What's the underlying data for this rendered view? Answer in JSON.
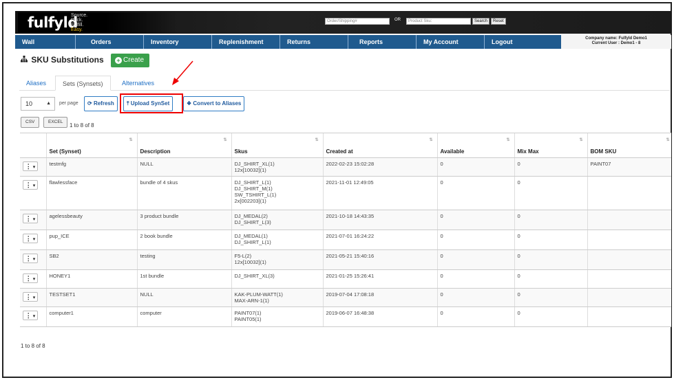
{
  "header": {
    "logo": "fulfyld",
    "tagline": [
      "Source.",
      "Pack.",
      "Fulfill.",
      "Easy."
    ],
    "order_placeholder": "Order/Shipping#",
    "or_label": "OR",
    "sku_placeholder": "Product Sku:",
    "search_label": "Search",
    "reset_label": "Reset"
  },
  "nav": [
    "Wall",
    "Orders",
    "Inventory",
    "Replenishment",
    "Returns",
    "Reports",
    "My Account",
    "Logout"
  ],
  "company": {
    "line1": "Company name: Fulfyld Demo1",
    "line2": "Current User : Demo1 - 8"
  },
  "page": {
    "title": "SKU Substitutions",
    "create_label": "Create"
  },
  "tabs": [
    "Aliases",
    "Sets (Synsets)",
    "Alternatives"
  ],
  "toolbar": {
    "per_page_value": "10",
    "per_page_label": "per page",
    "refresh_label": "Refresh",
    "upload_label": "Upload SynSet",
    "convert_label": "Convert to Aliases",
    "csv_label": "CSV",
    "excel_label": "EXCEL",
    "range_label": "1 to 8 of 8"
  },
  "table": {
    "headers": [
      "Set (Synset)",
      "Description",
      "Skus",
      "Created at",
      "Available",
      "Mix Max",
      "BOM SKU"
    ],
    "rows": [
      {
        "set": "testmfg",
        "description": "NULL",
        "skus": [
          "DJ_SHIRT_XL(1)",
          "12x[10032](1)"
        ],
        "created": "2022-02-23 15:02:28",
        "available": "0",
        "mixmax": "0",
        "bom": "PAINT07"
      },
      {
        "set": "flawlessface",
        "description": "bundle of 4 skus",
        "skus": [
          "DJ_SHIRT_L(1)",
          "DJ_SHIRT_M(1)",
          "SW_TSHIRT_L(1)",
          "2x[002203](1)"
        ],
        "created": "2021-11-01 12:49:05",
        "available": "0",
        "mixmax": "0",
        "bom": ""
      },
      {
        "set": "agelessbeauty",
        "description": "3 product bundle",
        "skus": [
          "DJ_MEDAL(2)",
          "DJ_SHIRT_L(3)"
        ],
        "created": "2021-10-18 14:43:35",
        "available": "0",
        "mixmax": "0",
        "bom": ""
      },
      {
        "set": "pup_ICE",
        "description": "2 book bundle",
        "skus": [
          "DJ_MEDAL(1)",
          "DJ_SHIRT_L(1)"
        ],
        "created": "2021-07-01 16:24:22",
        "available": "0",
        "mixmax": "0",
        "bom": ""
      },
      {
        "set": "SB2",
        "description": "testing",
        "skus": [
          "F5-L(2)",
          "12x[10032](1)"
        ],
        "created": "2021-05-21 15:40:16",
        "available": "0",
        "mixmax": "0",
        "bom": ""
      },
      {
        "set": "HONEY1",
        "description": "1st bundle",
        "skus": [
          "DJ_SHIRT_XL(3)"
        ],
        "created": "2021-01-25 15:26:41",
        "available": "0",
        "mixmax": "0",
        "bom": ""
      },
      {
        "set": "TESTSET1",
        "description": "NULL",
        "skus": [
          "KAK-PLUM-WATT(1)",
          "MAX-ARN-1(1)"
        ],
        "created": "2019-07-04 17:08:18",
        "available": "0",
        "mixmax": "0",
        "bom": ""
      },
      {
        "set": "computer1",
        "description": "computer",
        "skus": [
          "PAINT07(1)",
          "PAINT05(1)"
        ],
        "created": "2019-06-07 16:48:38",
        "available": "0",
        "mixmax": "0",
        "bom": ""
      }
    ]
  },
  "footer": {
    "range_label": "1 to 8 of 8"
  },
  "icons": {
    "title": "sitemap-icon",
    "create": "plus-circle-icon",
    "refresh": "refresh-icon",
    "upload": "upload-icon",
    "convert": "convert-icon",
    "row_action": "vertical-dots-icon"
  },
  "colors": {
    "nav": "#1f5a8e",
    "create": "#3aa04b",
    "highlight": "#e00000",
    "link": "#1f6fc4"
  }
}
